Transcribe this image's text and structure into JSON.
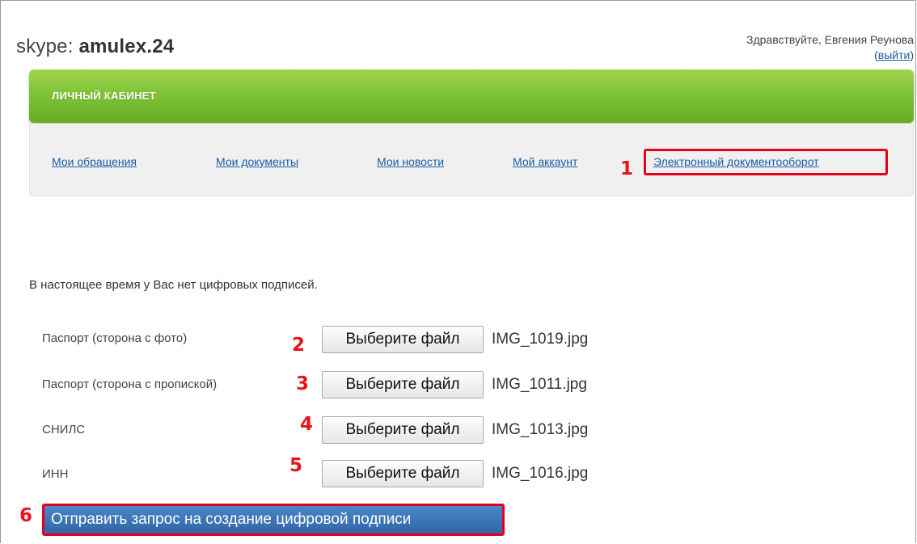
{
  "header": {
    "skype_prefix": "skype:",
    "skype_id": "amulex.24",
    "greeting": "Здравствуйте, Евгения Реунова",
    "logout_label": "выйти"
  },
  "cabinet": {
    "title": "ЛИЧНЫЙ КАБИНЕТ",
    "nav": [
      {
        "label": "Мои обращения"
      },
      {
        "label": "Мои документы"
      },
      {
        "label": "Мои новости"
      },
      {
        "label": "Мой аккаунт"
      },
      {
        "label": "Электронный документооборот"
      }
    ]
  },
  "main": {
    "notice": "В настоящее время у Вас нет цифровых подписей.",
    "files": [
      {
        "label": "Паспорт (сторона с фото)",
        "button": "Выберите файл",
        "filename": "IMG_1019.jpg"
      },
      {
        "label": "Паспорт (сторона с пропиской)",
        "button": "Выберите файл",
        "filename": "IMG_1011.jpg"
      },
      {
        "label": "СНИЛС",
        "button": "Выберите файл",
        "filename": "IMG_1013.jpg"
      },
      {
        "label": "ИНН",
        "button": "Выберите файл",
        "filename": "IMG_1016.jpg"
      }
    ],
    "submit_label": "Отправить запрос на создание цифровой подписи"
  },
  "annotations": {
    "markers": [
      "1",
      "2",
      "3",
      "4",
      "5",
      "6"
    ],
    "highlight_color": "#e4001b"
  },
  "colors": {
    "accent_green": "#7fc337",
    "link_blue": "#1a5ca8",
    "submit_blue": "#3e75b5"
  }
}
